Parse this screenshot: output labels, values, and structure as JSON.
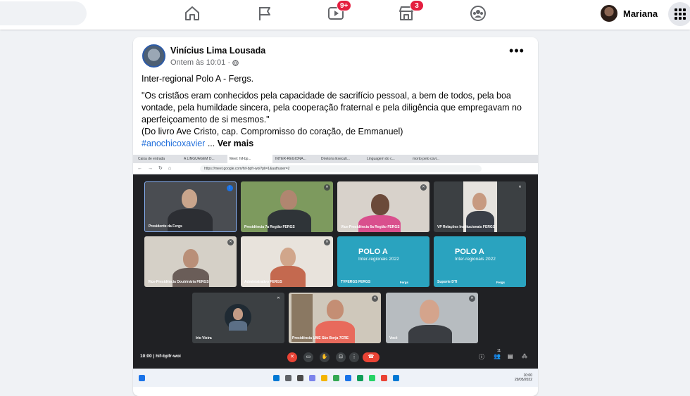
{
  "header": {
    "nav": {
      "home": "home-icon",
      "pages": "flag-icon",
      "watch": {
        "icon": "video-icon",
        "badge": "9+"
      },
      "marketplace": {
        "icon": "store-icon",
        "badge": "3"
      },
      "groups": "groups-icon"
    },
    "profile_name": "Mariana"
  },
  "post": {
    "author": "Vinícius Lima Lousada",
    "time": "Ontem às 10:01 ·",
    "line1": "Inter-regional Polo A - Fergs.",
    "quote": "\"Os cristãos eram conhecidos pela capacidade de sacrifício pessoal, a bem de todos, pela boa vontade, pela humildade sincera, pela cooperação fraternal e pela diligência que empregavam no aperfeiçoamento de si mesmos.\"",
    "source": "(Do livro Ave Cristo, cap. Compromisso do coração, de Emmanuel)",
    "hashtag": "#anochicoxavier",
    "ellipsis": " ... ",
    "see_more": "Ver mais",
    "more_icon": "•••"
  },
  "screenshot": {
    "tabs": [
      "Caixa de entrada",
      "A LINGUAGEM D...",
      "Meet: hif-bp...",
      "INTER-REGIONA...",
      "Diretoria Executi...",
      "Linguagem do c...",
      "morto pelo covi..."
    ],
    "url": "https://meet.google.com/hif-bpfr-woi?pli=1&authuser=2",
    "participants": [
      "Presidente da Fergs",
      "Presidência 7a Região FERGS",
      "Vice-Presidência 6a Região FERGS",
      "VP Relações Institucionais FERGS",
      "Vice-Presidência Doutrinária FERGS",
      "Administrativo FERGS",
      "TVFERGS FERGS",
      "Suporte DTI",
      "Irio Vieira",
      "Presidência UME São Borja 7CRE",
      "Você"
    ],
    "polo_title": "POLO A",
    "polo_sub": "Inter-regionais 2022",
    "polo_brand": "Fergs",
    "meet_time": "10:00",
    "meet_sep": "|",
    "meet_code": "hif-bpfr-woi",
    "people_count": "11",
    "clock_time": "10:00",
    "clock_date": "29/05/2022"
  }
}
